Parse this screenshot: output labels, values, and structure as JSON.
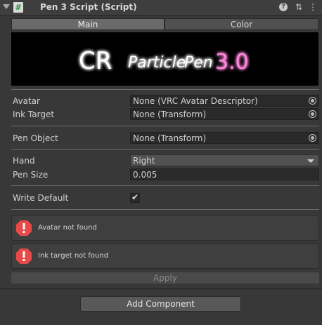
{
  "header": {
    "title": "Pen 3 Script (Script)",
    "script_icon_glyph": "#",
    "help_glyph": "?",
    "preset_glyph": "⇅",
    "menu_glyph": "⋮"
  },
  "tabs": [
    {
      "label": "Main",
      "selected": true
    },
    {
      "label": "Color",
      "selected": false
    }
  ],
  "banner": {
    "text_cr": "CR",
    "text_particle": "Particle",
    "text_pen": "Pen",
    "text_version": "3.0"
  },
  "fields": {
    "avatar": {
      "label": "Avatar",
      "value": "None (VRC Avatar Descriptor)"
    },
    "ink_target": {
      "label": "Ink Target",
      "value": "None (Transform)"
    },
    "pen_object": {
      "label": "Pen Object",
      "value": "None (Transform)"
    },
    "hand": {
      "label": "Hand",
      "value": "Right"
    },
    "pen_size": {
      "label": "Pen Size",
      "value": "0.005"
    },
    "write_default": {
      "label": "Write Default",
      "checked": true,
      "check_glyph": "✔"
    }
  },
  "messages": [
    {
      "text": "Avatar not found",
      "type": "error"
    },
    {
      "text": "Ink target not found",
      "type": "error"
    }
  ],
  "buttons": {
    "apply": "Apply",
    "add_component": "Add Component"
  },
  "colors": {
    "background": "#383838",
    "error": "#e84a4a",
    "banner_glow_white": "#ffffff",
    "banner_glow_pink": "#ff66cc"
  }
}
